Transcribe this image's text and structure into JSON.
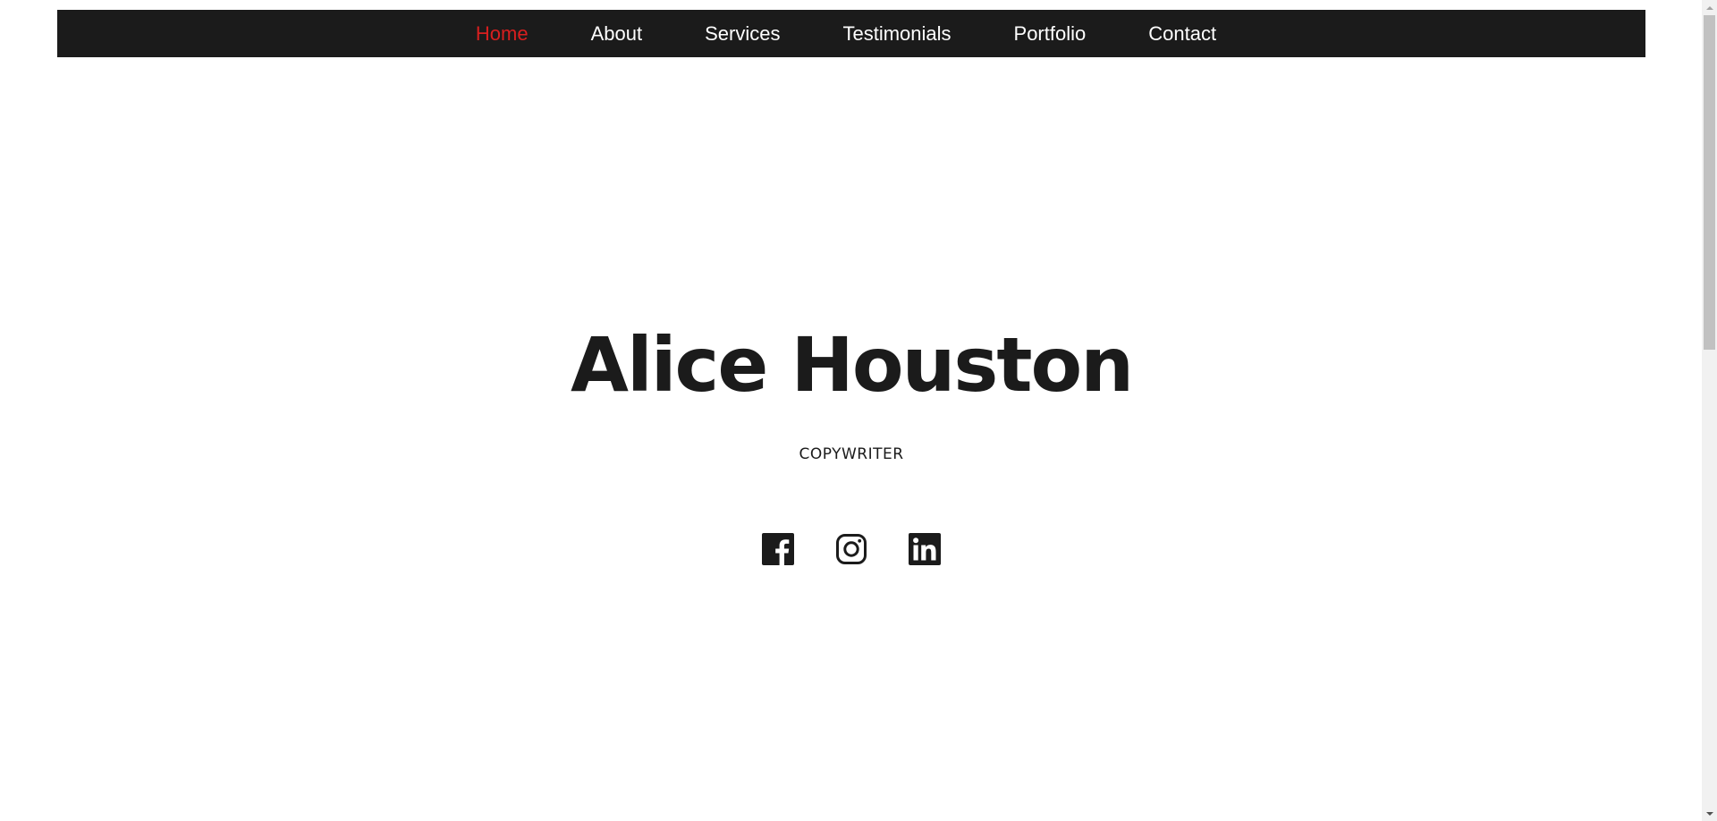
{
  "nav": {
    "items": [
      {
        "label": "Home",
        "active": true
      },
      {
        "label": "About",
        "active": false
      },
      {
        "label": "Services",
        "active": false
      },
      {
        "label": "Testimonials",
        "active": false
      },
      {
        "label": "Portfolio",
        "active": false
      },
      {
        "label": "Contact",
        "active": false
      }
    ]
  },
  "hero": {
    "name": "Alice Houston",
    "role": "COPYWRITER"
  },
  "social": {
    "icons": [
      "facebook-icon",
      "instagram-icon",
      "linkedin-icon"
    ]
  },
  "colors": {
    "nav_background": "#1b1b1b",
    "nav_text": "#ffffff",
    "nav_active": "#d81f1f",
    "text_dark": "#1b1b1b",
    "page_background": "#ffffff"
  }
}
